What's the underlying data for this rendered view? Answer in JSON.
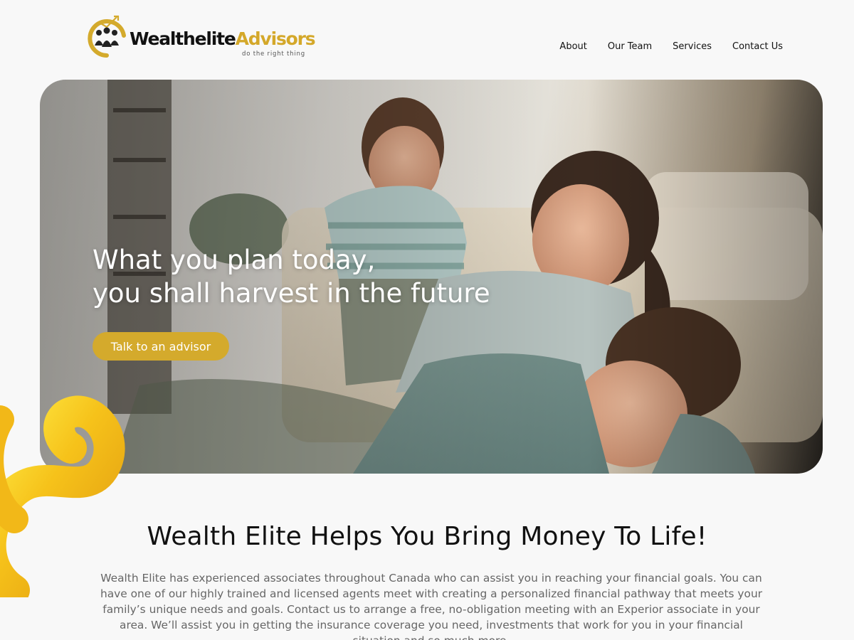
{
  "brand": {
    "name_part1": "Wealthelite",
    "name_part2": "Advisors",
    "tagline": "do the right thing",
    "colors": {
      "gold": "#d4aa2c",
      "dark": "#111111"
    }
  },
  "nav": {
    "items": [
      {
        "label": "About"
      },
      {
        "label": "Our Team"
      },
      {
        "label": "Services"
      },
      {
        "label": "Contact Us"
      }
    ]
  },
  "hero": {
    "line1": "What you plan today,",
    "line2": "you shall harvest in the future",
    "cta_label": "Talk to an advisor",
    "photo_icon": "family-photo"
  },
  "section": {
    "title": "Wealth Elite Helps You Bring Money To Life!",
    "body": "Wealth Elite has experienced associates throughout Canada who can assist you in reaching your financial goals. You can have one of our highly trained and licensed agents meet with creating a personalized financial pathway that meets your family’s unique needs and goals. Contact us to arrange a free, no-obligation meeting with an Experior associate in your area. We’ll assist you in getting the insurance coverage you need, investments that work for you in your financial situation and so much more."
  }
}
